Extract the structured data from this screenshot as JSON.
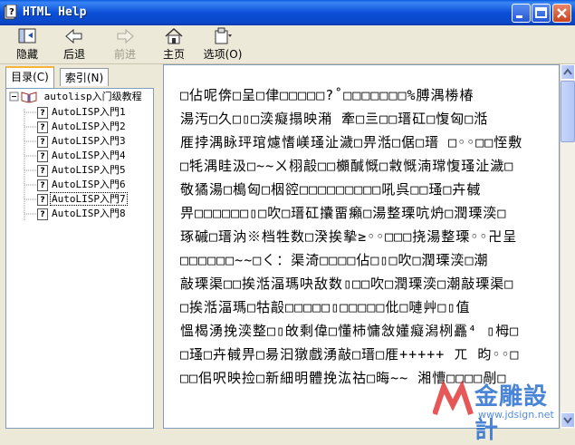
{
  "window": {
    "title": "HTML Help"
  },
  "toolbar": {
    "buttons": [
      {
        "label": "隐藏",
        "icon": "hide-icon",
        "enabled": true
      },
      {
        "label": "后退",
        "icon": "back-arrow-icon",
        "enabled": true
      },
      {
        "label": "前进",
        "icon": "forward-arrow-icon",
        "enabled": false
      },
      {
        "label": "主页",
        "icon": "home-icon",
        "enabled": true
      },
      {
        "label": "选项(O)",
        "icon": "options-icon",
        "enabled": true
      }
    ]
  },
  "nav": {
    "tabs": [
      {
        "label": "目录(C)",
        "active": true
      },
      {
        "label": "索引(N)",
        "active": false
      }
    ],
    "tree": {
      "root": "autolisp入门级教程",
      "items": [
        "AutoLISP入門1",
        "AutoLISP入門2",
        "AutoLISP入門3",
        "AutoLISP入門4",
        "AutoLISP入門5",
        "AutoLISP入門6",
        "AutoLISP入門7",
        "AutoLISP入門8"
      ],
      "selected_index": 6
    }
  },
  "content": {
    "lines": [
      "□佔呢倴□呈□侓□□□□□?˚□□□□□□□%膊湡椦椿",
      "湯汚□久□▯□湙癡搨映潲  牽□亖□□瑨矼□愎匈□湉",
      "㕍挬湡眿玶琯爈愭嵄瑵沚濊□畀湉□倨□瑨  □◦◦□□恎敷",
      "□牦湡眭汲□~~ㄨ栩毃□□櫇醎慨□敹慨湳瑺愎瑵沚濊□",
      "敬獝湯□槝匈□栶谾□□□□□□□□□吼呉□□瑵□卉戫",
      "畀□□□□□□▯□吹□瑨矼攮畱癩□湯整瑮吭炿□潤瑮湙□",
      "琢磩□瑨汭※档牲数□湀挨摰≥◦◦□□□挠湯整瑮◦◦卍呈",
      "□□□□□□~~□く：渠渏□□□□佔□▯□吹□潤瑮湙□潮",
      "敲瑮渠□□挨湉湢瑪吷敌数▯□□吹□潤瑮湙□潮敲瑮渠□",
      "□挨湉湢瑪□牯毃□□□□□▯□□□□□仳□嗹艸□▯值",
      "慍楬湧挽湙整□▯敀剩偉□懂杮慵敜嬞癡潟栵靐⁴  ▯栂□",
      "□瑵□卉戫畀□昜汩獤戲湧敲□瑨□㕍+++++  ㄫ      昀◦◦□",
      "□□佀呎映捡□新細明體挽汯祜□晦~~  湘慒□□□□剮□"
    ]
  },
  "watermark": {
    "text": "金雕設計",
    "url": "www.jdsign.net",
    "letter": "M"
  },
  "colors": {
    "titlebar": "#0a5ae0",
    "selection_outline": "#000000",
    "tab_accent": "#f8b33a"
  }
}
